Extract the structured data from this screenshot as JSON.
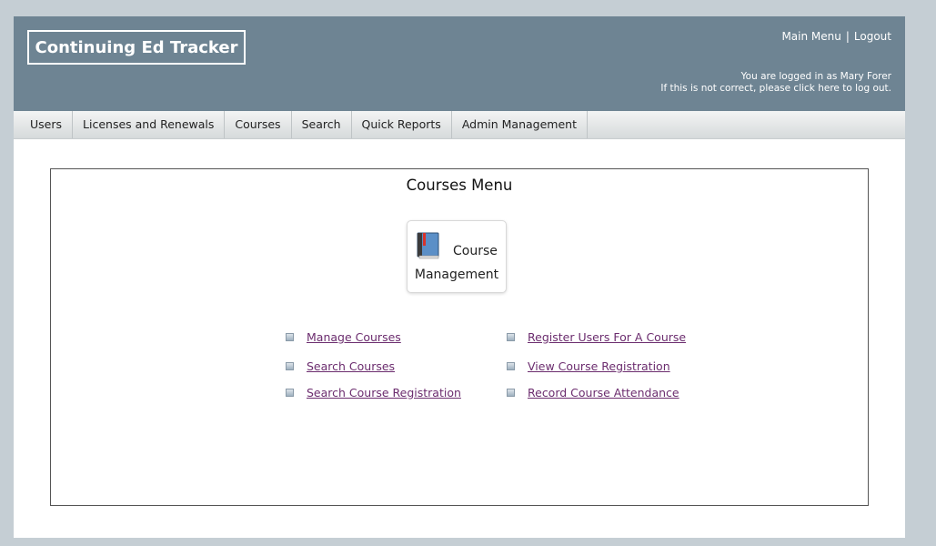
{
  "header": {
    "logo": "Continuing Ed Tracker",
    "main_menu": "Main Menu",
    "separator": "|",
    "logout": "Logout",
    "login_line1": "You are logged in as Mary Forer",
    "login_line2_pre": "If this is not correct, please click ",
    "login_line2_link": "here",
    "login_line2_post": " to log out."
  },
  "nav": {
    "items": [
      "Users",
      "Licenses and Renewals",
      "Courses",
      "Search",
      "Quick Reports",
      "Admin Management"
    ]
  },
  "panel": {
    "title": "Courses Menu",
    "module_line1": "Course",
    "module_line2": "Management",
    "module_icon": "book-icon"
  },
  "links": {
    "left": [
      "Manage Courses",
      "Search Courses",
      "Search Course Registration"
    ],
    "right": [
      "Register Users For A Course",
      "View Course Registration",
      "Record Course Attendance"
    ]
  },
  "colors": {
    "header_bg": "#6e8493",
    "link": "#6b2c6e",
    "page_bg": "#c5ced4"
  }
}
